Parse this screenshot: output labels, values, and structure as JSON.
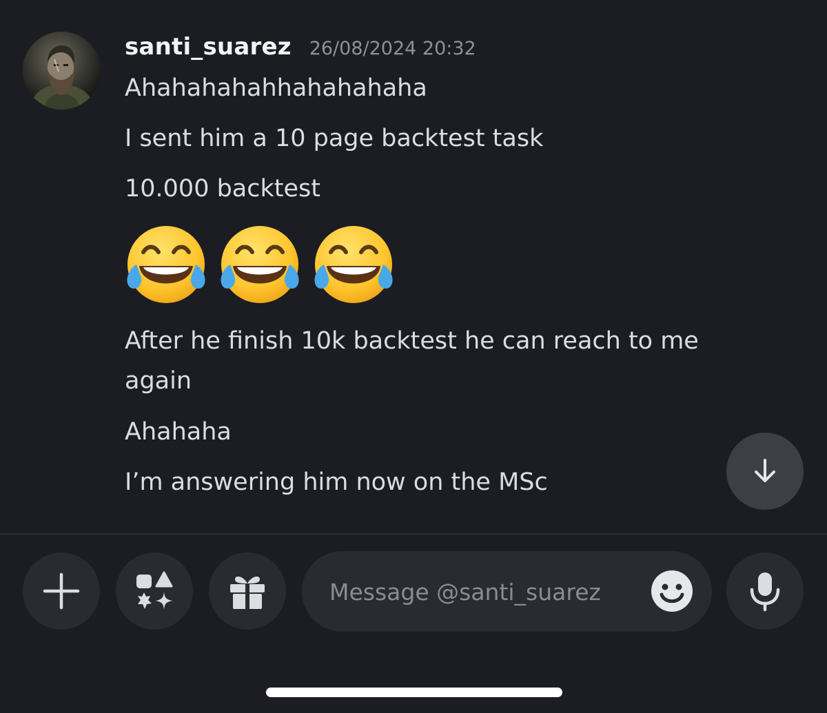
{
  "message": {
    "username": "santi_suarez",
    "timestamp": "26/08/2024 20:32",
    "lines": [
      "Ahahahahahhahahahaha",
      "I sent him a 10 page backtest task",
      "10.000 backtest",
      "After he finish 10k backtest he can reach to me again",
      "Ahahaha",
      "I’m answering him now on the MSc"
    ],
    "emoji_row": [
      "face-with-tears-of-joy-emoji",
      "face-with-tears-of-joy-emoji",
      "face-with-tears-of-joy-emoji"
    ]
  },
  "composer": {
    "placeholder": "Message @santi_suarez",
    "buttons": [
      "plus-icon",
      "apps-icon",
      "gift-icon",
      "emoji-icon",
      "microphone-icon"
    ]
  },
  "scroll": {
    "icon": "arrow-down-icon"
  },
  "colors": {
    "background": "#1c1d22",
    "button_bg": "#2a2b31",
    "text": "#dcdde1",
    "username": "#f2f3f5",
    "timestamp": "#8f9198"
  }
}
